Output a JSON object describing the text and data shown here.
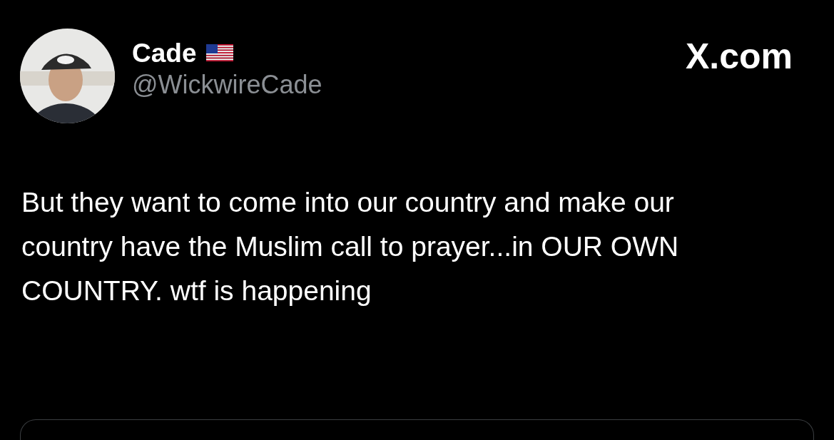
{
  "header": {
    "author_name": "Cade",
    "verified_flag": true,
    "handle": "@WickwireCade",
    "site": "X.com"
  },
  "post": {
    "text": "But they want to come into our country and make our country have the Muslim call to prayer...in OUR OWN COUNTRY. wtf is happening"
  }
}
